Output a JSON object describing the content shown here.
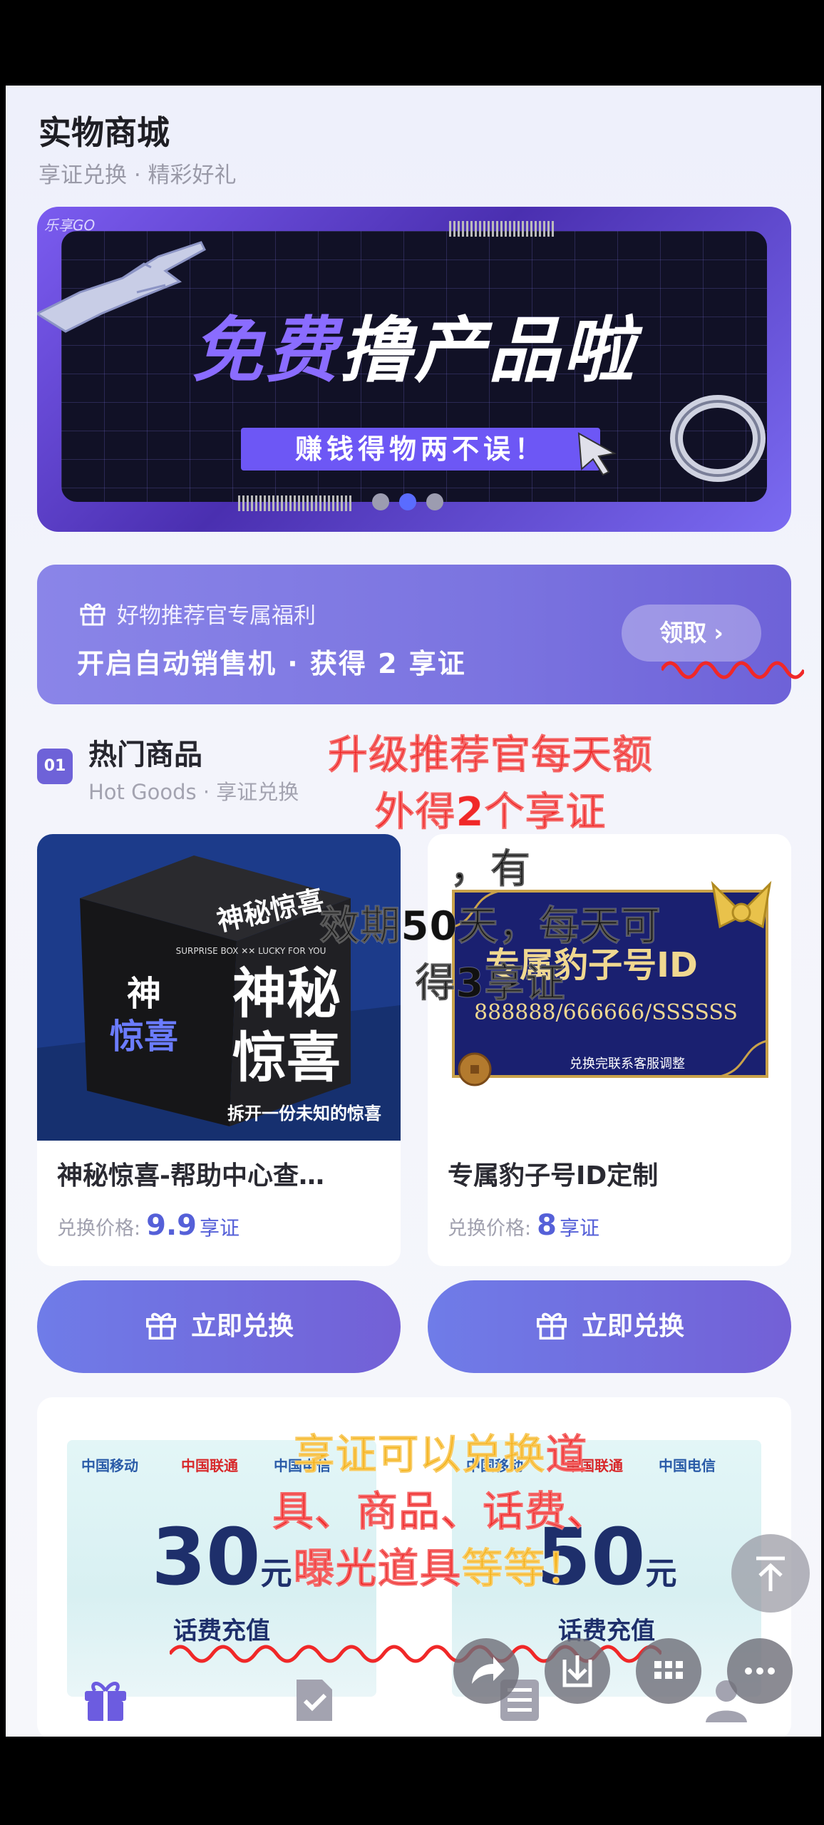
{
  "header": {
    "title": "实物商城",
    "subtitle": "享证兑换 · 精彩好礼"
  },
  "banner": {
    "logo": "乐享GO",
    "title_part1": "免费",
    "title_part2": "撸产品啦",
    "slogan": "赚钱得物两不误！",
    "active_dot": 1,
    "dot_count": 3
  },
  "welfare": {
    "label": "好物推荐官专属福利",
    "headline": "开启自动销售机 · 获得 2 享证",
    "claim_button": "领取"
  },
  "hot_section": {
    "badge": "01",
    "title": "热门商品",
    "subtitle": "Hot Goods · 享证兑换"
  },
  "products": [
    {
      "name": "神秘惊喜-帮助中心查…",
      "price_label": "兑换价格:",
      "price": "9.9",
      "unit": "享证",
      "image_text_main": "神秘惊喜",
      "image_text_top": "神秘惊喜",
      "image_text_strip": "SURPRISE BOX ✕✕ LUCKY FOR YOU",
      "image_text_bottom": "拆开一份未知的惊喜",
      "button": "立即兑换"
    },
    {
      "name": "专属豹子号ID定制",
      "price_label": "兑换价格:",
      "price": "8",
      "unit": "享证",
      "image_text_main": "专属豹子号ID",
      "image_text_numbers": "888888/666666/SSSSSS",
      "image_text_bottom": "兑换完联系客服调整",
      "button": "立即兑换"
    }
  ],
  "recharge": [
    {
      "carrier1": "中国移动",
      "carrier2": "中国联通",
      "carrier3": "中国电信",
      "amount": "30",
      "currency": "元",
      "label": "话费充值"
    },
    {
      "carrier1": "中国移动",
      "carrier2": "中国联通",
      "carrier3": "中国电信",
      "amount": "50",
      "currency": "元",
      "label": "话费充值"
    }
  ],
  "annotations": {
    "note1_line1": "升级推荐官每天额",
    "note1_line2_red": "外得2个享证",
    "note1_line2_rest": "，有",
    "note1_line3": "效期50天，每天可",
    "note1_line4": "得3享证",
    "note2_line1_yellow": "享证可以兑换",
    "note2_line1_red": "道",
    "note2_line2": "具、商品、话费、",
    "note2_line3_red": "曝光道具",
    "note2_line3_yellow": "等等！"
  },
  "colors": {
    "accent": "#6e62d8",
    "price": "#5560d8",
    "annotation_red": "#f02828",
    "annotation_yellow": "#f5b31c"
  },
  "tabs": [
    {
      "icon": "gift-icon"
    },
    {
      "icon": "check-doc-icon"
    },
    {
      "icon": "list-icon"
    },
    {
      "icon": "user-icon"
    }
  ]
}
